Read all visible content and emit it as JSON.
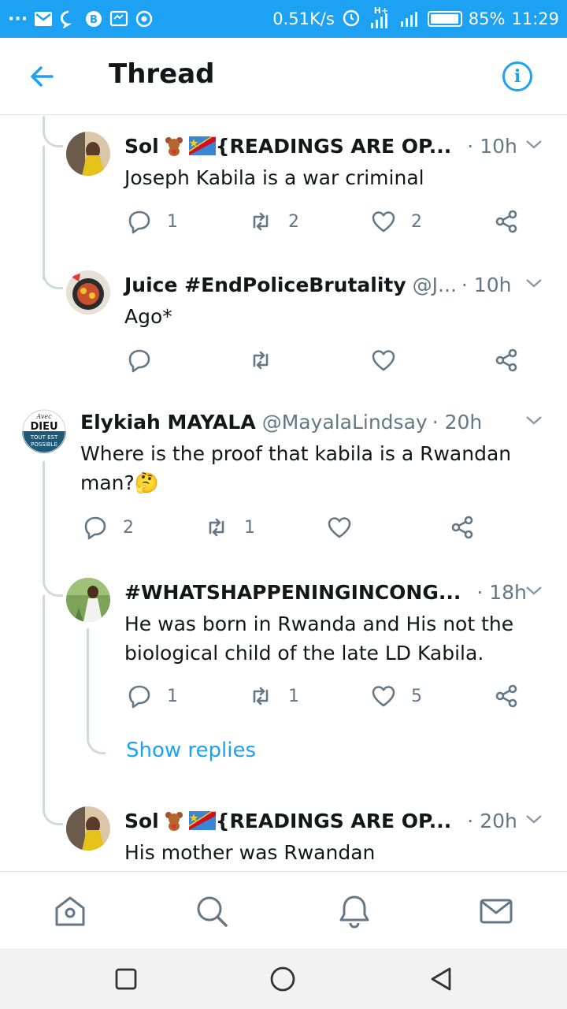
{
  "status_bar": {
    "dots": "···",
    "network_speed": "0.51K/s",
    "network_type": "H+",
    "battery": "85%",
    "time": "11:29"
  },
  "header": {
    "title": "Thread",
    "back_icon": "arrow-left-icon",
    "info_icon": "info-icon",
    "info_glyph": "i"
  },
  "tweets": [
    {
      "name": "Sol",
      "name_suffix": "{READINGS ARE OP...",
      "handle": "",
      "time": "· 10h",
      "text": "Joseph Kabila is a war criminal",
      "replies": "1",
      "retweets": "2",
      "likes": "2"
    },
    {
      "name": "Juice #EndPoliceBrutality",
      "name_suffix": "",
      "handle": "@J...",
      "time": "· 10h",
      "text": "Ago*",
      "replies": "",
      "retweets": "",
      "likes": ""
    },
    {
      "name": "Elykiah MAYALA",
      "name_suffix": "",
      "handle": "@MayalaLindsay",
      "time": "· 20h",
      "text_line1": "Where is the proof that kabila is a Rwandan",
      "text_line2": "man?🤔",
      "replies": "2",
      "retweets": "1",
      "likes": ""
    },
    {
      "name": "#WHATSHAPPENINGINCONG...",
      "name_suffix": "",
      "handle": "",
      "time": "· 18h",
      "text_line1": "He was born in Rwanda and His not the",
      "text_line2": "biological child of the late LD Kabila.",
      "replies": "1",
      "retweets": "1",
      "likes": "5"
    },
    {
      "name": "Sol",
      "name_suffix": "{READINGS ARE OP...",
      "handle": "",
      "time": "· 20h",
      "text": "His mother was Rwandan"
    }
  ],
  "show_replies": "Show replies",
  "avatar_text": {
    "line1": "Avec",
    "line2": "DIEU",
    "line3": "TOUT EST",
    "line4": "POSSIBLE"
  },
  "bottom_nav": [
    "home-icon",
    "search-icon",
    "notifications-icon",
    "messages-icon"
  ],
  "system_nav": [
    "recents-square-icon",
    "home-circle-icon",
    "back-triangle-icon"
  ]
}
